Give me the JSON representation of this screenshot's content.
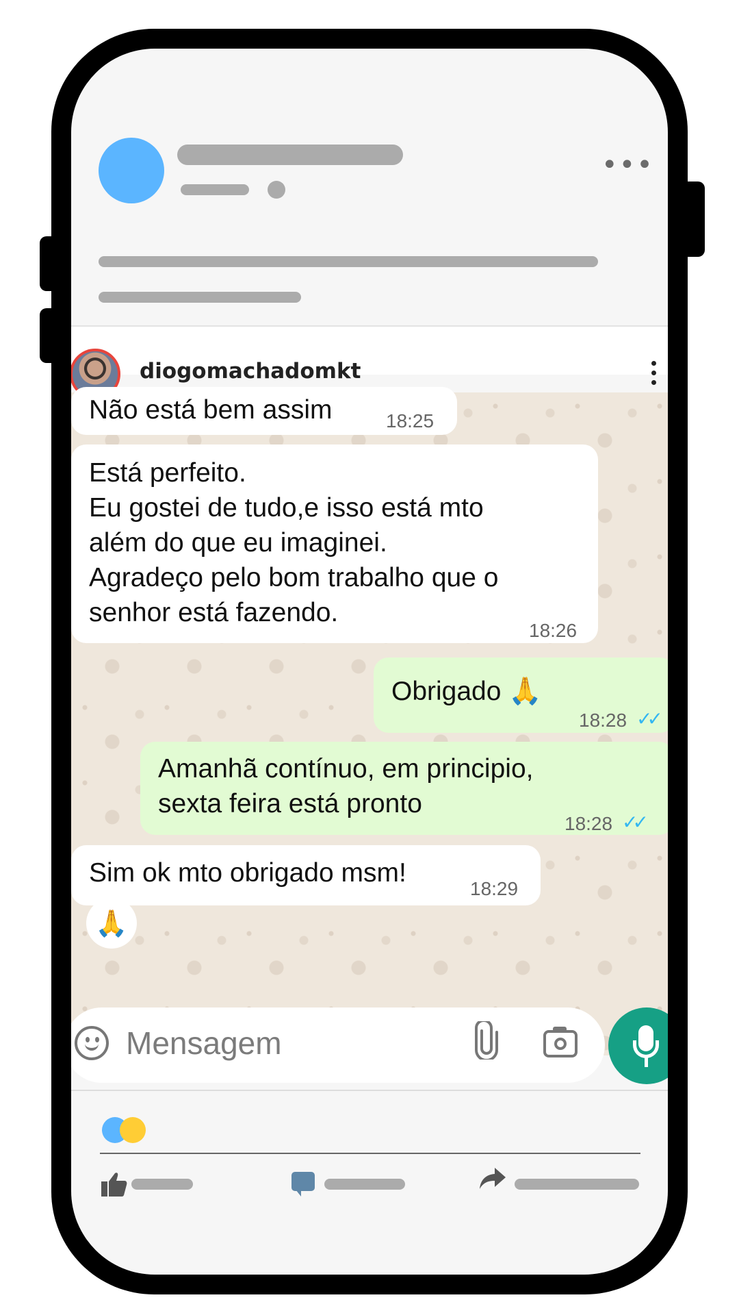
{
  "instagram": {
    "username": "diogomachadomkt"
  },
  "messages": [
    {
      "direction": "in",
      "lines": [
        "Não está bem assim"
      ],
      "time": "18:25"
    },
    {
      "direction": "in",
      "lines": [
        "Está perfeito.",
        "Eu gostei de tudo,e isso está mto",
        "além do que eu imaginei.",
        "Agradeço pelo bom trabalho que o",
        "senhor está fazendo."
      ],
      "time": "18:26"
    },
    {
      "direction": "out",
      "lines": [
        "Obrigado 🙏"
      ],
      "time": "18:28",
      "ticks": "✓✓"
    },
    {
      "direction": "out",
      "lines": [
        "Amanhã contínuo,  em principio,",
        "sexta feira está pronto"
      ],
      "time": "18:28",
      "ticks": "✓✓"
    },
    {
      "direction": "in",
      "lines": [
        "Sim ok mto obrigado msm!"
      ],
      "time": "18:29",
      "reaction": "🙏"
    }
  ],
  "input": {
    "placeholder": "Mensagem"
  },
  "icons": {
    "emoji": "emoji-icon",
    "attach": "paperclip-icon",
    "camera": "camera-icon",
    "mic": "microphone-icon",
    "more_horizontal": "more-horizontal-icon",
    "more_vertical": "more-vertical-icon",
    "like": "thumbs-up-icon",
    "comment": "comment-icon",
    "share": "share-icon"
  },
  "colors": {
    "post_avatar": "#5bb5ff",
    "outgoing_bubble": "#e2fbd3",
    "incoming_bubble": "#ffffff",
    "chat_background": "#efe7dc",
    "mic_button": "#16a085",
    "read_ticks": "#34b7f1",
    "reaction_blue": "#5bb5ff",
    "reaction_yellow": "#ffcd35"
  }
}
